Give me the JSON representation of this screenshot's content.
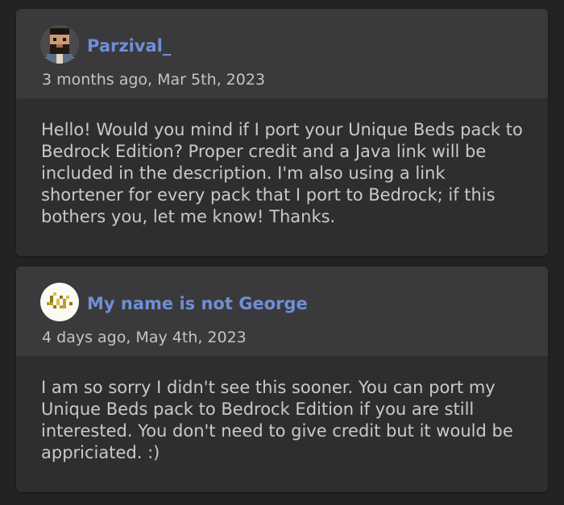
{
  "comments": [
    {
      "author": "Parzival_",
      "timestamp": "3 months ago, Mar 5th, 2023",
      "avatar_icon": "pixel-bearded-man-avatar-icon",
      "body": "Hello! Would you mind if I port your Unique Beds pack to Bedrock Edition? Proper credit and a Java link will be included in the description. I'm also using a link shortener for every pack that I port to Bedrock; if this bothers you, let me know! Thanks."
    },
    {
      "author": "My name is not George",
      "timestamp": "4 days ago, May 4th, 2023",
      "avatar_icon": "pixel-gold-nuggets-avatar-icon",
      "body": "I am so sorry I didn't see this sooner. You can port my Unique Beds pack to Bedrock Edition if you are still interested. You don't need to give credit but it would be appriciated. :)"
    }
  ],
  "colors": {
    "page_background": "#222222",
    "card_header": "#3a3a3c",
    "card_body": "#2e2e30",
    "author_link": "#6f8fd6",
    "body_text": "#c9c9c9",
    "timestamp_text": "#c4c4c4"
  }
}
